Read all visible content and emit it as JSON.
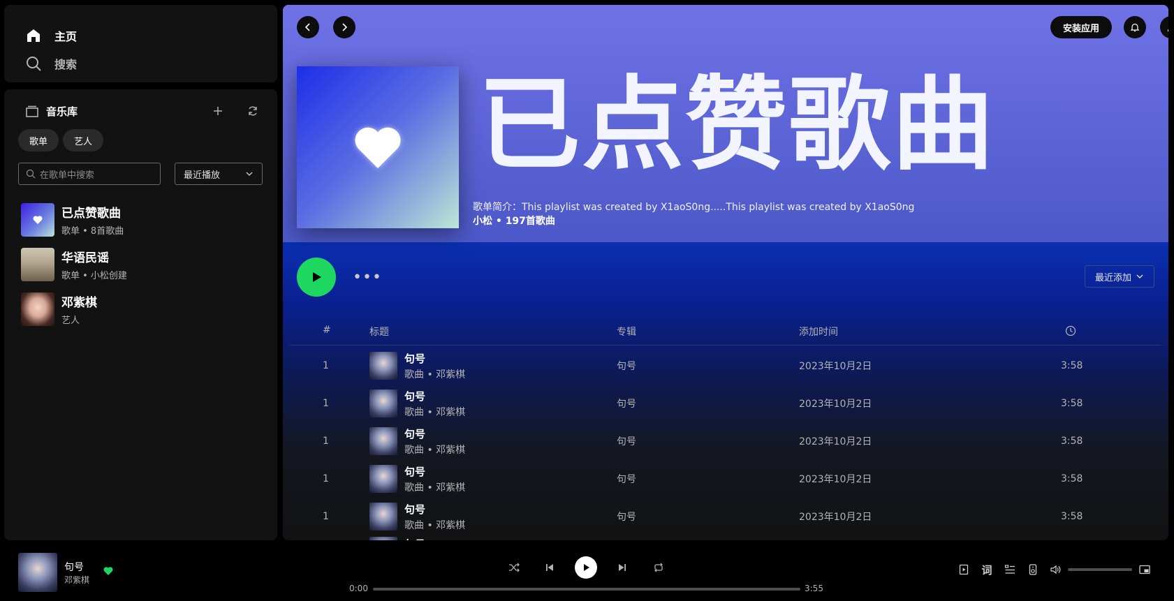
{
  "nav": {
    "home": "主页",
    "search": "搜索"
  },
  "library": {
    "title": "音乐库",
    "chips": [
      "歌单",
      "艺人"
    ],
    "search_placeholder": "在歌单中搜索",
    "sort": "最近播放",
    "items": [
      {
        "name": "已点赞歌曲",
        "sub": "歌单 • 8首歌曲"
      },
      {
        "name": "华语民谣",
        "sub": "歌单 • 小松创建"
      },
      {
        "name": "邓紫棋",
        "sub": "艺人"
      }
    ]
  },
  "header": {
    "install": "安装应用"
  },
  "playlist": {
    "title": "已点赞歌曲",
    "description": "歌单简介：This playlist was created by X1aoS0ng.....This playlist was created by X1aoS0ng",
    "meta": "小松 • 197首歌曲",
    "more": "•••",
    "sort": "最近添加"
  },
  "table": {
    "headers": {
      "index": "#",
      "title": "标题",
      "album": "专辑",
      "added": "添加时间"
    },
    "rows": [
      {
        "index": "1",
        "title": "句号",
        "sub": "歌曲 • 邓紫棋",
        "album": "句号",
        "added": "2023年10月2日",
        "duration": "3:58"
      },
      {
        "index": "1",
        "title": "句号",
        "sub": "歌曲 • 邓紫棋",
        "album": "句号",
        "added": "2023年10月2日",
        "duration": "3:58"
      },
      {
        "index": "1",
        "title": "句号",
        "sub": "歌曲 • 邓紫棋",
        "album": "句号",
        "added": "2023年10月2日",
        "duration": "3:58"
      },
      {
        "index": "1",
        "title": "句号",
        "sub": "歌曲 • 邓紫棋",
        "album": "句号",
        "added": "2023年10月2日",
        "duration": "3:58"
      },
      {
        "index": "1",
        "title": "句号",
        "sub": "歌曲 • 邓紫棋",
        "album": "句号",
        "added": "2023年10月2日",
        "duration": "3:58"
      }
    ],
    "partial_row_title": "句号"
  },
  "player": {
    "title": "句号",
    "artist": "邓紫棋",
    "current_time": "0:00",
    "total_time": "3:55",
    "progress": 0,
    "lyrics_label": "词",
    "liked": true
  },
  "colors": {
    "accent": "#1ed760",
    "hero_top": "#6f72e6",
    "hero_bottom": "#4c58c8"
  },
  "icons": [
    "home-icon",
    "search-icon",
    "library-icon",
    "plus-icon",
    "refresh-icon",
    "heart-icon",
    "chevron-left-icon",
    "chevron-right-icon",
    "bell-icon",
    "user-icon",
    "play-icon",
    "clock-icon",
    "shuffle-icon",
    "previous-icon",
    "next-icon",
    "repeat-icon",
    "now-playing-view-icon",
    "queue-icon",
    "device-icon",
    "volume-icon",
    "mini-player-icon"
  ]
}
